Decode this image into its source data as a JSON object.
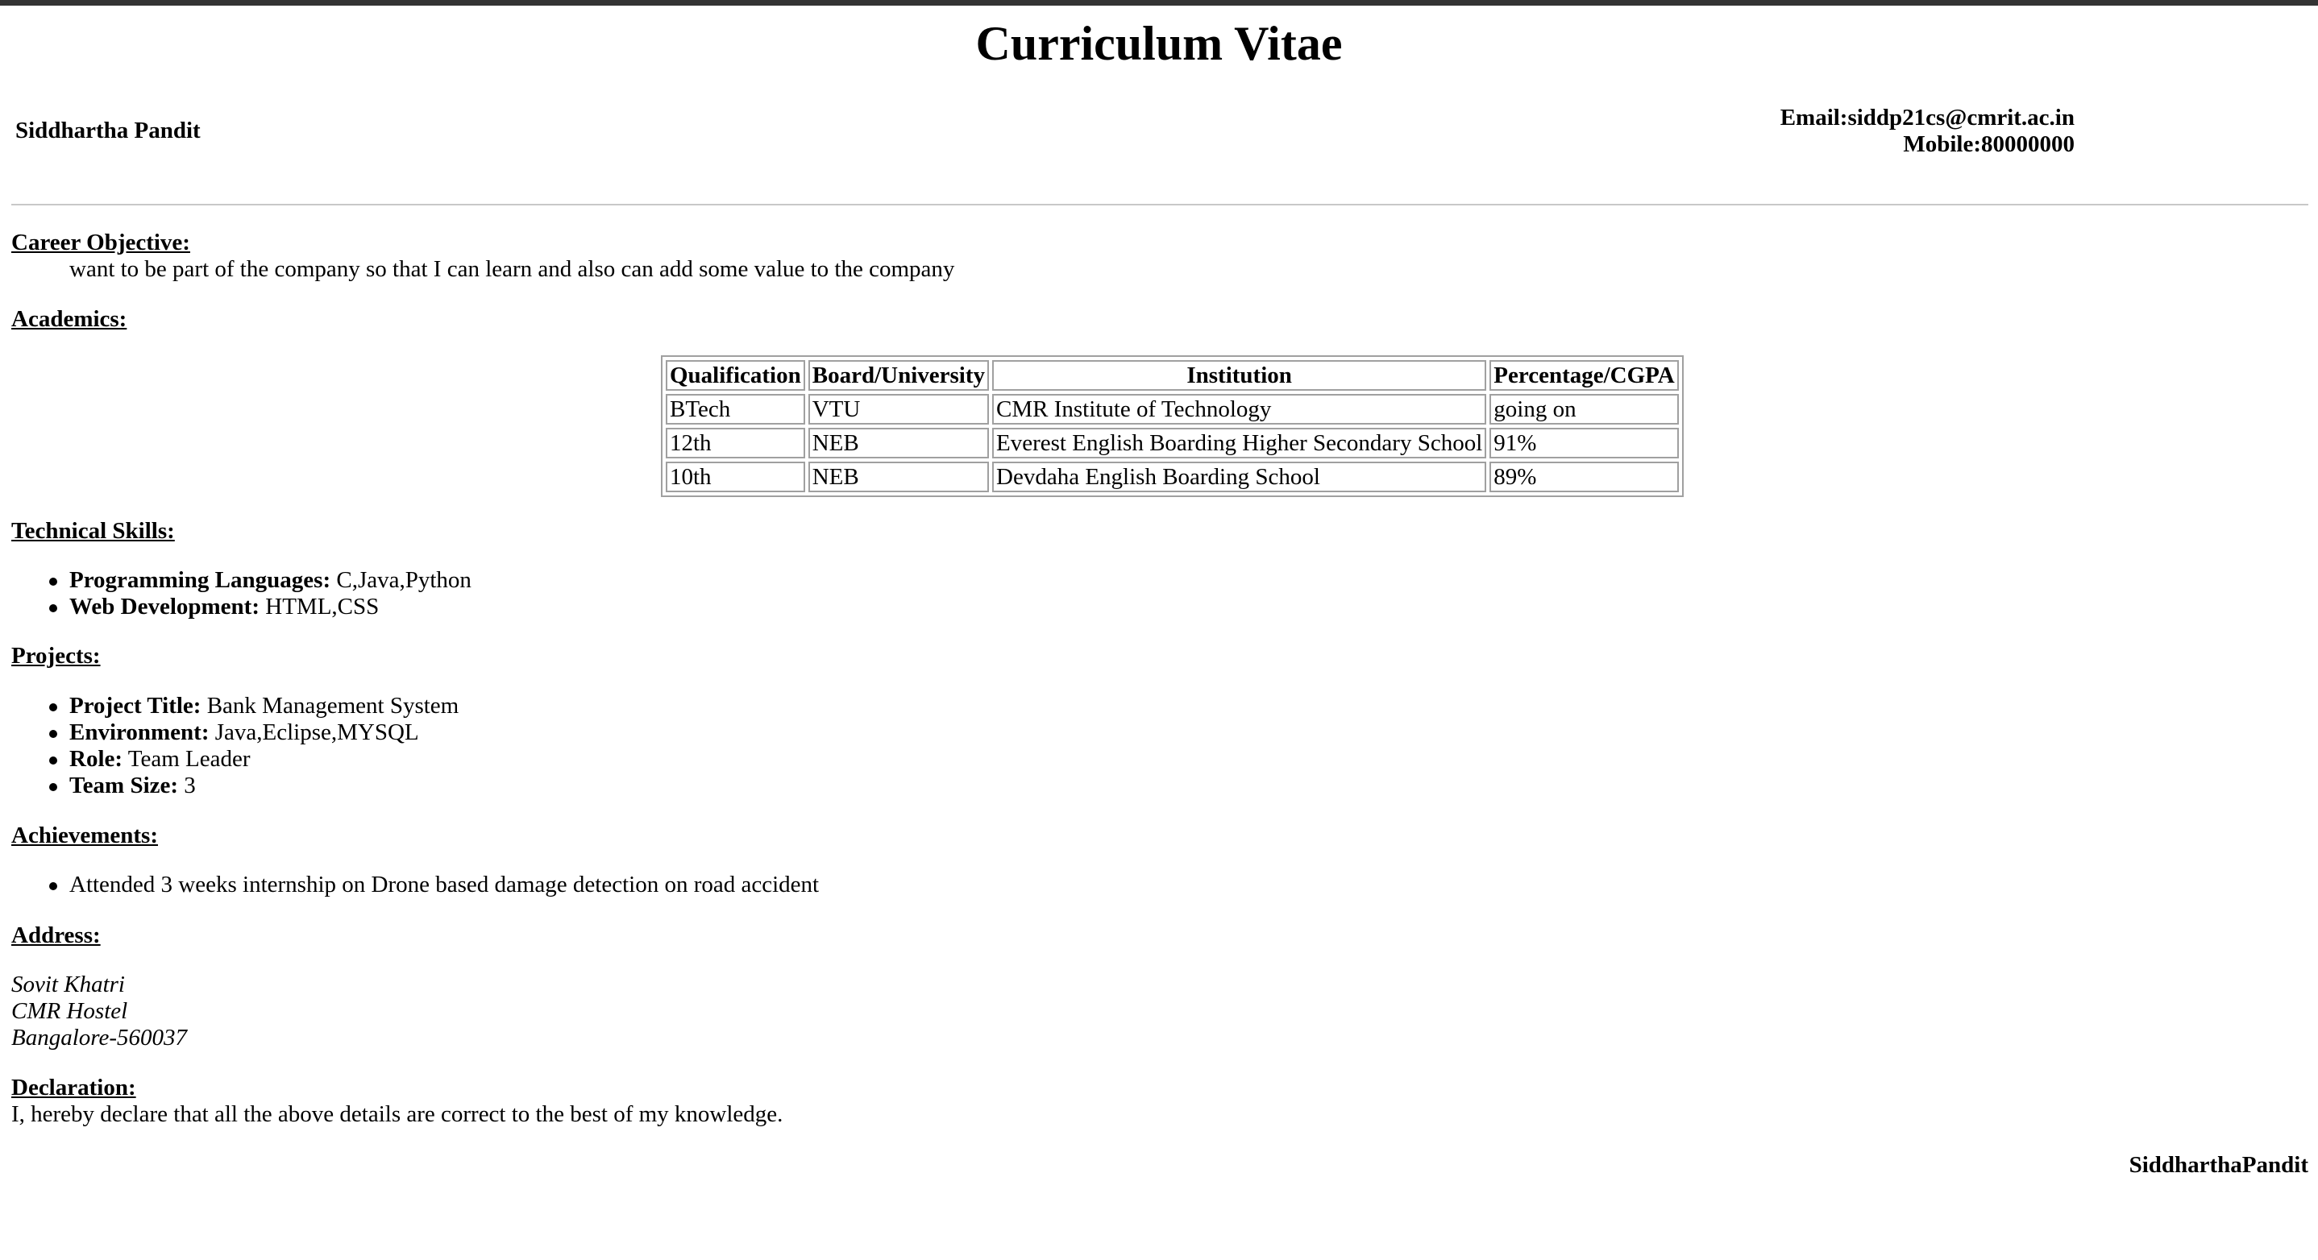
{
  "title": "Curriculum Vitae",
  "name": "Siddhartha Pandit",
  "contact": {
    "email": "Email:siddp21cs@cmrit.ac.in",
    "mobile": "Mobile:80000000"
  },
  "career": {
    "heading": "Career Objective:",
    "text": "want to be part of the company so that I can learn and also can add some value to the company"
  },
  "academics": {
    "heading": "Academics:",
    "headers": [
      "Qualification",
      "Board/University",
      "Institution",
      "Percentage/CGPA"
    ],
    "rows": [
      [
        "BTech",
        "VTU",
        "CMR Institute of Technology",
        "going on"
      ],
      [
        "12th",
        "NEB",
        "Everest English Boarding Higher Secondary School",
        "91%"
      ],
      [
        "10th",
        "NEB",
        "Devdaha English Boarding School",
        "89%"
      ]
    ]
  },
  "skills": {
    "heading": "Technical Skills:",
    "items": [
      {
        "label": "Programming Languages:",
        "value": " C,Java,Python"
      },
      {
        "label": "Web Development:",
        "value": " HTML,CSS"
      }
    ]
  },
  "projects": {
    "heading": "Projects:",
    "items": [
      {
        "label": "Project Title:",
        "value": " Bank Management System"
      },
      {
        "label": "Environment:",
        "value": " Java,Eclipse,MYSQL"
      },
      {
        "label": "Role:",
        "value": " Team Leader"
      },
      {
        "label": "Team Size:",
        "value": " 3"
      }
    ]
  },
  "achievements": {
    "heading": "Achievements:",
    "items": [
      "Attended 3 weeks internship on Drone based damage detection on road accident"
    ]
  },
  "address": {
    "heading": "Address:",
    "lines": [
      "Sovit Khatri",
      "CMR Hostel",
      "Bangalore-560037"
    ]
  },
  "declaration": {
    "heading": "Declaration:",
    "text": "I, hereby declare that all the above details are correct to the best of my knowledge."
  },
  "signature": "SiddharthaPandit"
}
